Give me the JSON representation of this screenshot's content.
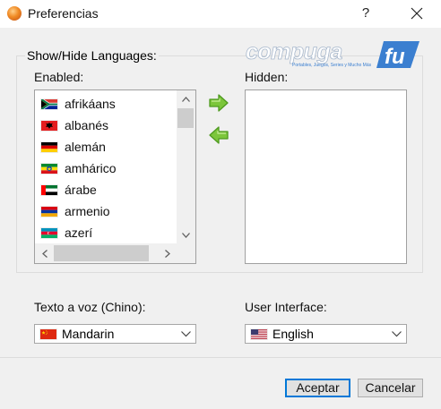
{
  "window": {
    "title": "Preferencias",
    "help": "?"
  },
  "group": {
    "legend": "Show/Hide Languages:"
  },
  "watermark": {
    "brand": "compuga",
    "suffix": "fu",
    "tagline": "Portables, Juegos, Series y Mucho Más"
  },
  "enabled": {
    "label": "Enabled:",
    "items": [
      {
        "label": "afrikáans",
        "flag": "south-africa"
      },
      {
        "label": "albanés",
        "flag": "albania"
      },
      {
        "label": "alemán",
        "flag": "germany"
      },
      {
        "label": "amhárico",
        "flag": "ethiopia"
      },
      {
        "label": "árabe",
        "flag": "uae"
      },
      {
        "label": "armenio",
        "flag": "armenia"
      },
      {
        "label": "azerí",
        "flag": "azerbaijan"
      }
    ]
  },
  "hidden": {
    "label": "Hidden:",
    "items": []
  },
  "tts": {
    "label": "Texto a voz (Chino):",
    "value": "Mandarin",
    "flag": "china"
  },
  "ui": {
    "label": "User Interface:",
    "value": "English",
    "flag": "usa"
  },
  "buttons": {
    "ok": "Aceptar",
    "cancel": "Cancelar"
  },
  "colors": {
    "arrow_green": "#7cc63b",
    "accent_blue": "#0078d7"
  },
  "icons": {
    "move_right": "green-right-arrow-icon",
    "move_left": "green-left-arrow-icon"
  }
}
